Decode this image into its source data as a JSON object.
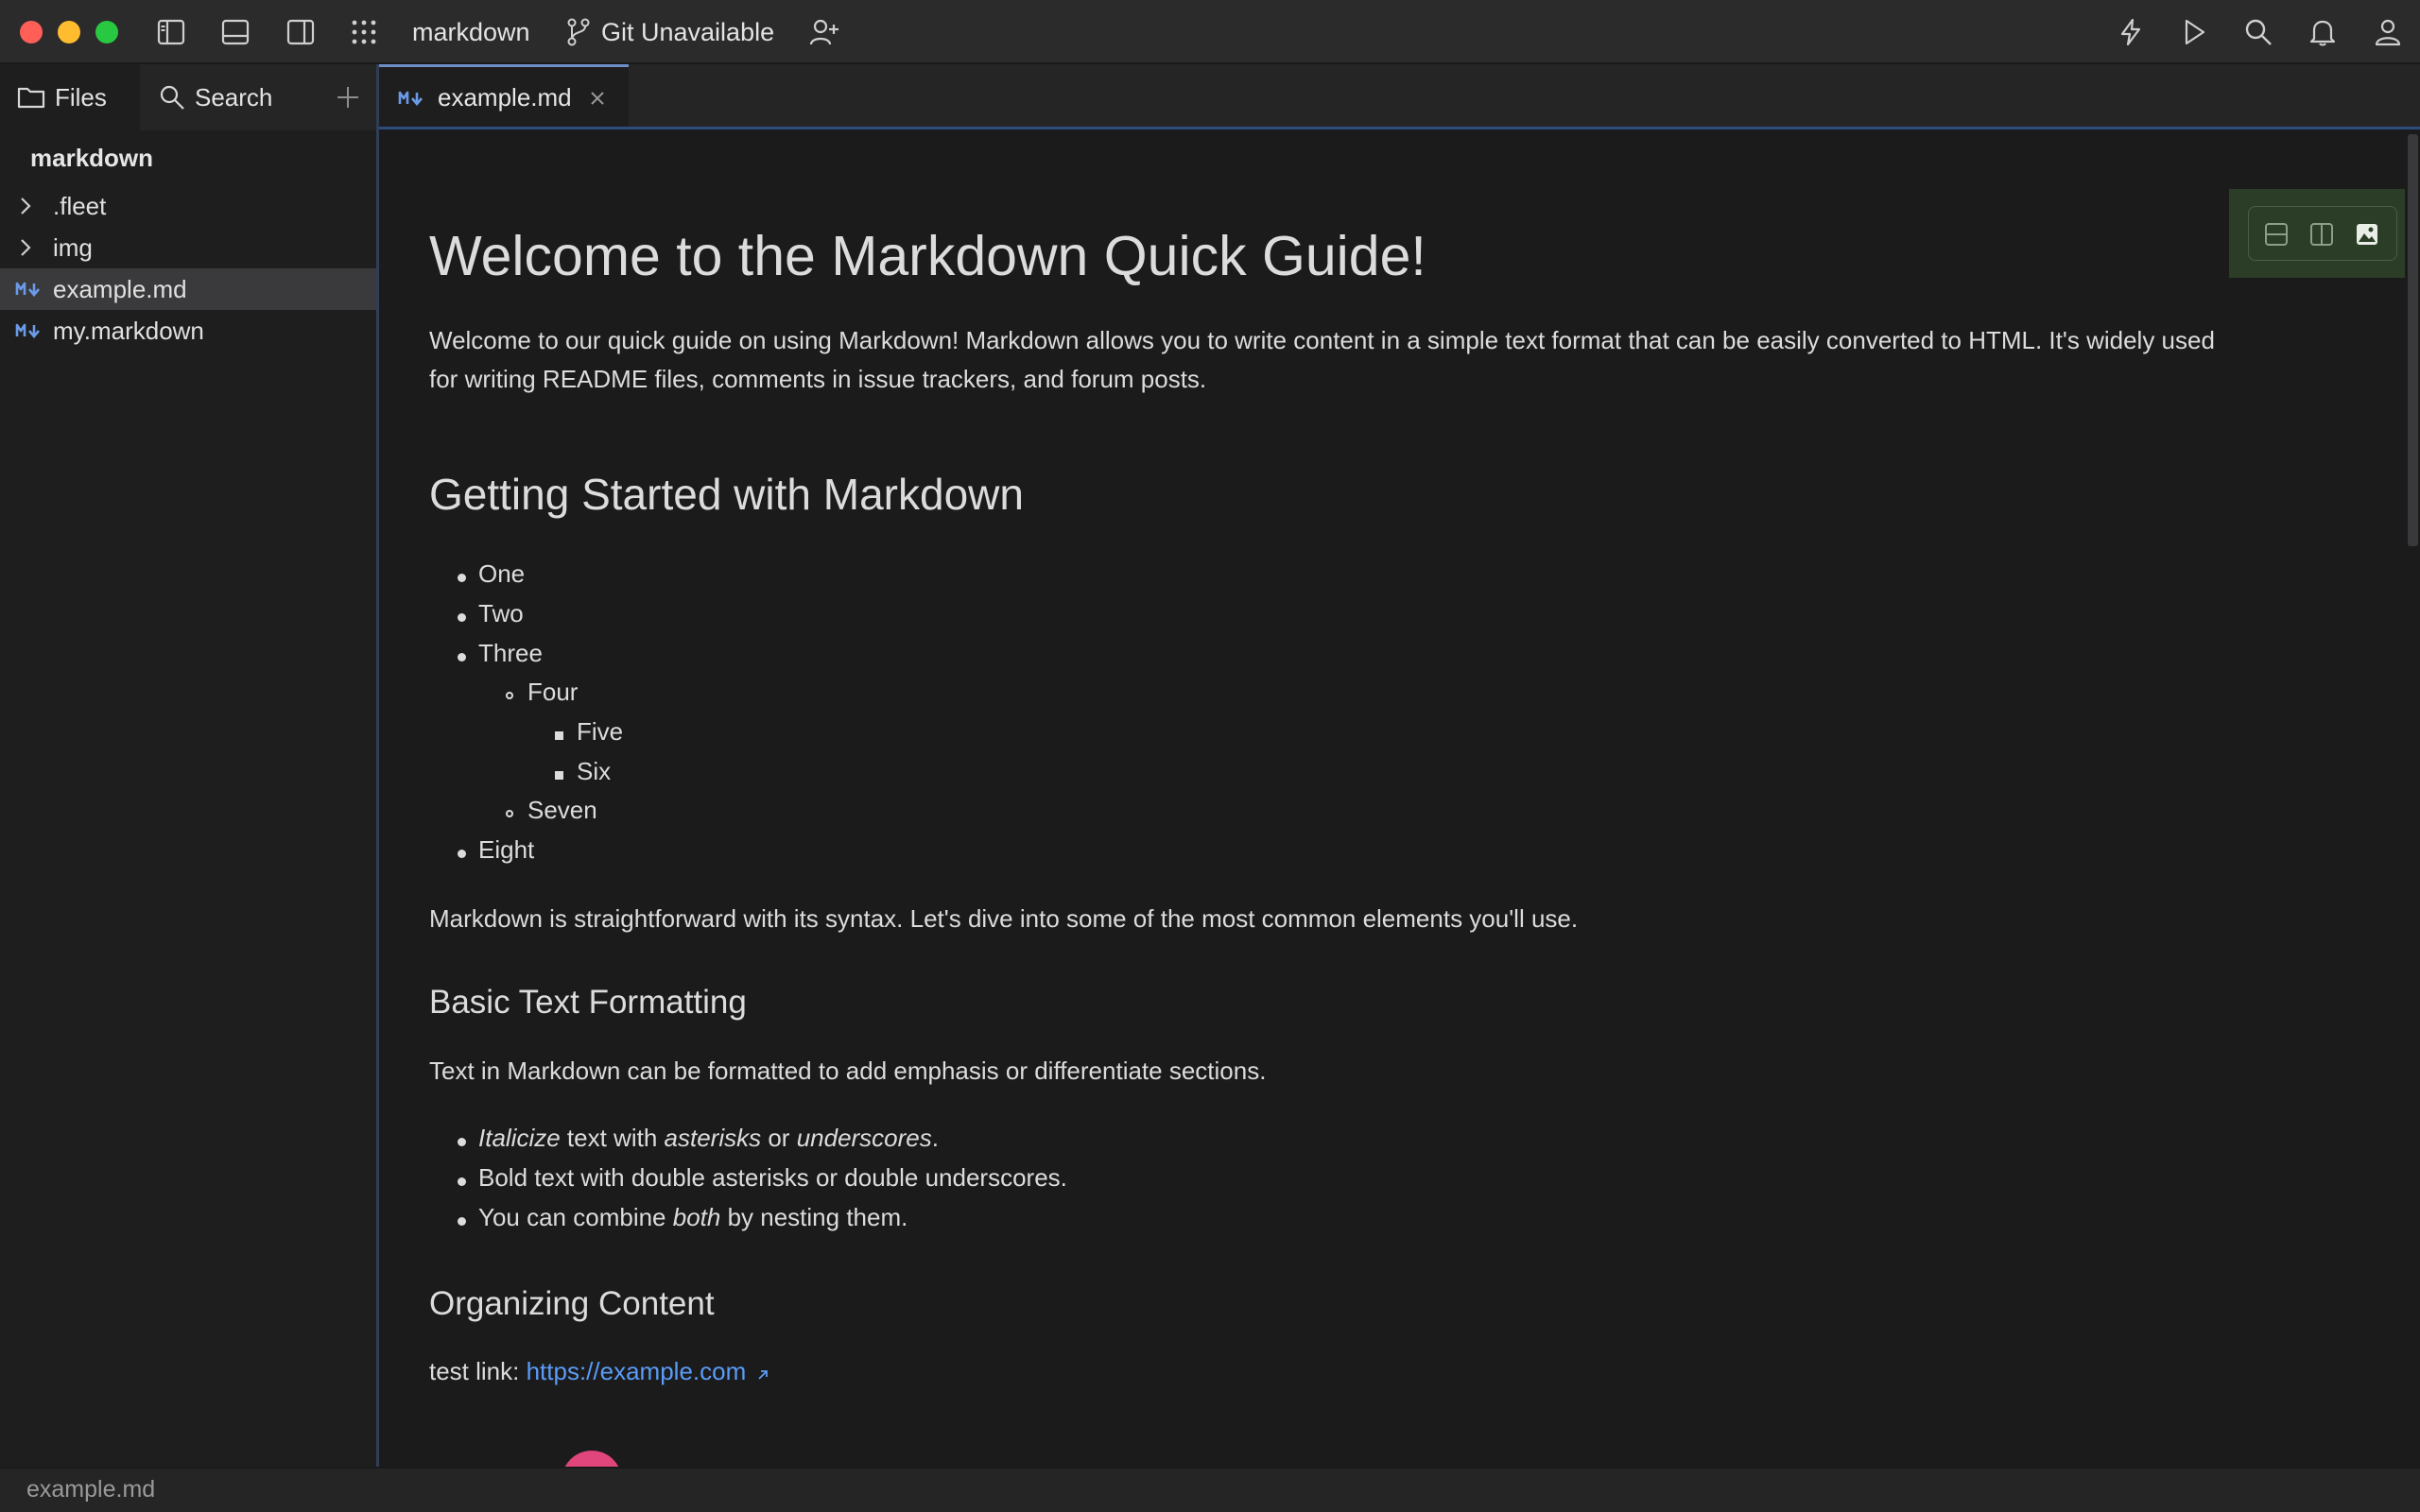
{
  "window": {
    "project_name": "markdown",
    "git_status": "Git Unavailable"
  },
  "sidebar": {
    "tabs": [
      {
        "label": "Files",
        "icon": "folder-icon"
      },
      {
        "label": "Search",
        "icon": "search-icon"
      }
    ],
    "project_title": "markdown",
    "tree": [
      {
        "label": ".fleet",
        "type": "folder"
      },
      {
        "label": "img",
        "type": "folder"
      },
      {
        "label": "example.md",
        "type": "markdown-file",
        "selected": true
      },
      {
        "label": "my.markdown",
        "type": "markdown-file"
      }
    ]
  },
  "editor_tabs": [
    {
      "label": "example.md",
      "active": true
    }
  ],
  "document": {
    "h1": "Welcome to the Markdown Quick Guide!",
    "intro_line1": "Welcome to our quick guide on using Markdown! Markdown allows you to write content in a simple text format that can be easily converted to HTML. It's widely used",
    "intro_line2": "for writing README files, comments in issue trackers, and forum posts.",
    "h2": "Getting Started with Markdown",
    "list": [
      "One",
      "Two",
      "Three",
      "Four",
      "Five",
      "Six",
      "Seven",
      "Eight"
    ],
    "syntax_para": "Markdown is straightforward with its syntax. Let's dive into some of the most common elements you'll use.",
    "h3_formatting": "Basic Text Formatting",
    "formatting_para": "Text in Markdown can be formatted to add emphasis or differentiate sections.",
    "fmt_item1": {
      "em1": "Italicize",
      "t1": " text with ",
      "em2": "asterisks",
      "t2": " or ",
      "em3": "underscores",
      "t3": "."
    },
    "fmt_item2": "Bold text with double asterisks or double underscores.",
    "fmt_item3": {
      "t1": "You can combine ",
      "em": "both",
      "t2": " by nesting them."
    },
    "h3_organizing": "Organizing Content",
    "link_label": "test link: ",
    "link_url": "https://example.com"
  },
  "status_bar": {
    "file": "example.md"
  },
  "colors": {
    "accent": "#5a9cf8",
    "markdown_icon": "#6b9ae8",
    "close_red": "#ff5f57",
    "minimize_yellow": "#febc2e",
    "zoom_green": "#28c840",
    "preview_toolbar_bg": "#2c3d27"
  }
}
